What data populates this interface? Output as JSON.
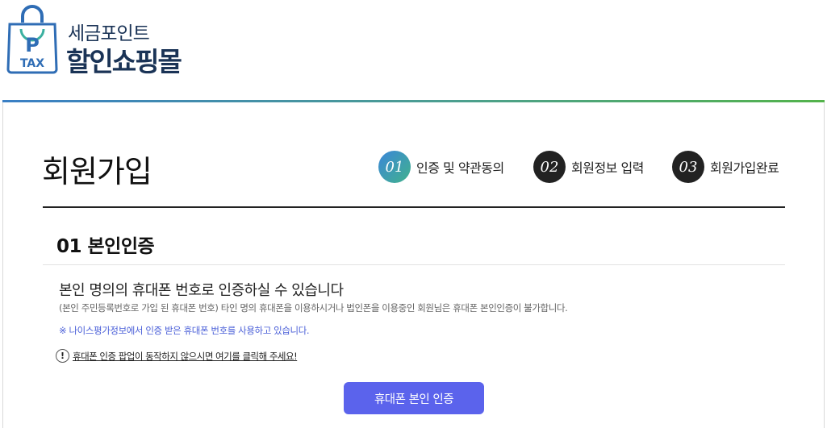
{
  "header": {
    "logo_badge_letter": "P",
    "logo_badge_sub": "TAX",
    "brand_top": "세금포인트",
    "brand_main": "할인쇼핑몰",
    "accent_gradient": [
      "#3a7fc5",
      "#53b34b"
    ]
  },
  "page": {
    "title": "회원가입"
  },
  "steps": [
    {
      "number": "01",
      "label": "인증 및 약관동의",
      "state": "active"
    },
    {
      "number": "02",
      "label": "회원정보 입력",
      "state": "inactive"
    },
    {
      "number": "03",
      "label": "회원가입완료",
      "state": "inactive"
    }
  ],
  "section": {
    "title": "01 본인인증",
    "lead": "본인 명의의 휴대폰 번호로 인증하실 수 있습니다",
    "sub": "(본인 주민등록번호로 가입 된 휴대폰 번호) 타인 명의 휴대폰을 이용하시거나 법인폰을 이용중인 회원님은 휴대폰 본인인증이 불가합니다.",
    "note": "※ 나이스평가정보에서 인증 받은 휴대폰 번호를 사용하고 있습니다.",
    "help_icon": "!",
    "help_link": "휴대폰 인증 팝업이 동작하지 않으시면 여기를 클릭해 주세요!",
    "button_label": "휴대폰 본인 인증",
    "button_color": "#5b63ec"
  }
}
